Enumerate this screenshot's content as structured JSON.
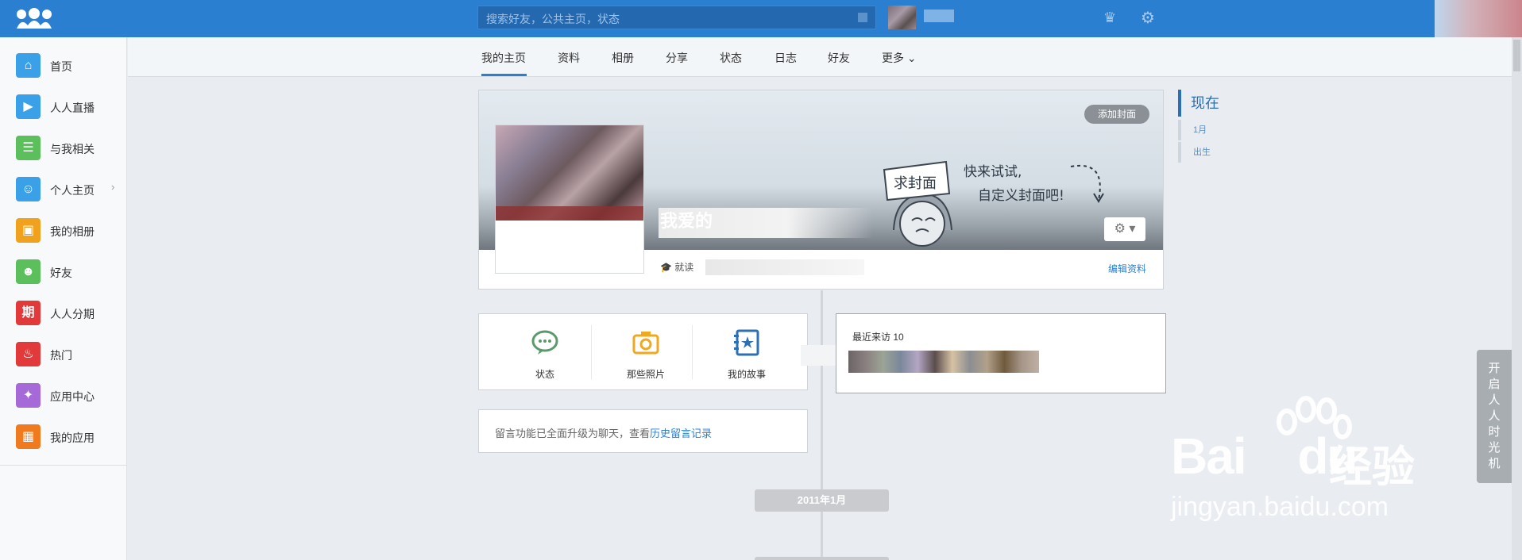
{
  "topbar": {
    "search_placeholder": "搜索好友，公共主页，状态",
    "icons": [
      "renren-logo",
      "search-icon",
      "crown-icon",
      "gear-icon"
    ]
  },
  "sidebar": {
    "items": [
      {
        "label": "首页",
        "icon": "home-icon",
        "color": "#3aa0e8"
      },
      {
        "label": "人人直播",
        "icon": "video-icon",
        "color": "#3aa0e8"
      },
      {
        "label": "与我相关",
        "icon": "related-icon",
        "color": "#5bbf5b"
      },
      {
        "label": "个人主页",
        "icon": "user-icon",
        "color": "#3aa0e8"
      },
      {
        "label": "我的相册",
        "icon": "album-icon",
        "color": "#f0a21e"
      },
      {
        "label": "好友",
        "icon": "friends-icon",
        "color": "#5bbf5b"
      },
      {
        "label": "人人分期",
        "icon": "installment-icon",
        "color": "#e23a3a",
        "glyph": "期"
      },
      {
        "label": "热门",
        "icon": "hot-icon",
        "color": "#e23a3a"
      },
      {
        "label": "应用中心",
        "icon": "gamepad-icon",
        "color": "#a66ad8"
      },
      {
        "label": "我的应用",
        "icon": "apps-icon",
        "color": "#f07b1e"
      }
    ]
  },
  "tabs": [
    {
      "label": "我的主页",
      "active": true
    },
    {
      "label": "资料"
    },
    {
      "label": "相册"
    },
    {
      "label": "分享"
    },
    {
      "label": "状态"
    },
    {
      "label": "日志"
    },
    {
      "label": "好友"
    },
    {
      "label": "更多"
    }
  ],
  "cover": {
    "add_cover": "添加封面",
    "sign_text": "求封面",
    "slogan_line1": "快来试试,",
    "slogan_line2": "自定义封面吧!",
    "name": "我爱的",
    "school_prefix": "就读",
    "edit_profile": "编辑资料"
  },
  "actions": [
    {
      "label": "状态",
      "icon": "speech-bubble-icon",
      "color": "#5aa06a"
    },
    {
      "label": "那些照片",
      "icon": "camera-icon",
      "color": "#f0a81e"
    },
    {
      "label": "我的故事",
      "icon": "story-book-icon",
      "color": "#2b6fb5"
    }
  ],
  "visitors": {
    "title": "最近来访 10"
  },
  "message": {
    "text": "留言功能已全面升级为聊天，查看",
    "link": "历史留言记录"
  },
  "timeline": {
    "now": "现在",
    "items": [
      "1月",
      "出生"
    ],
    "year_badge": "2011年1月"
  },
  "time_machine": [
    "开",
    "启",
    "人",
    "人",
    "时",
    "光",
    "机"
  ],
  "watermark": {
    "main": "Bai",
    "main2": "du",
    "cn": "经验",
    "url": "jingyan.baidu.com"
  }
}
